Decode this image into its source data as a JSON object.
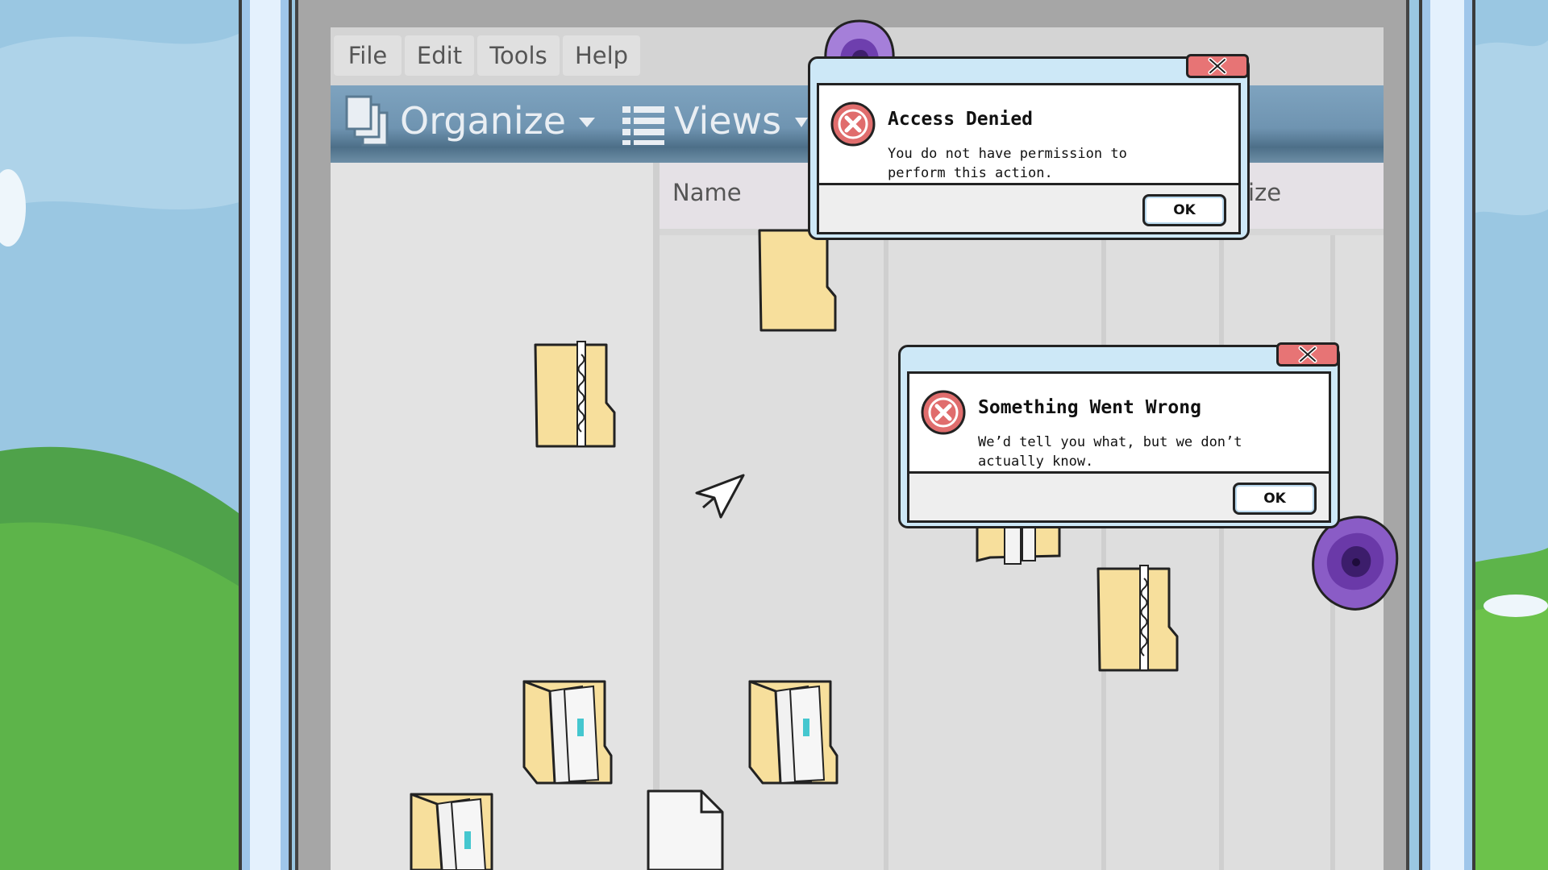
{
  "menu": {
    "items": [
      "File",
      "Edit",
      "Tools",
      "Help"
    ]
  },
  "toolbar": {
    "organize_label": "Organize",
    "views_label": "Views"
  },
  "columns": {
    "name_header": "Name",
    "size_header_visible": "ize"
  },
  "dialogs": [
    {
      "title": "Access Denied",
      "message": "You do not have permission to\nperform this action.",
      "ok_label": "OK"
    },
    {
      "title": "Something Went Wrong",
      "message": "We’d tell you what, but we don’t\nactually know.",
      "ok_label": "OK"
    }
  ],
  "icons": [
    "close-icon",
    "error-icon",
    "cursor-icon",
    "folder-icon",
    "zip-folder-icon",
    "document-icon",
    "purple-blob"
  ],
  "colors": {
    "toolbar": "#6f94b1",
    "folder": "#f7df9c",
    "dialog_frame": "#cde8f7",
    "close_button": "#e77475",
    "error_icon": "#e06d6d",
    "blob": "#8a5cc6"
  }
}
